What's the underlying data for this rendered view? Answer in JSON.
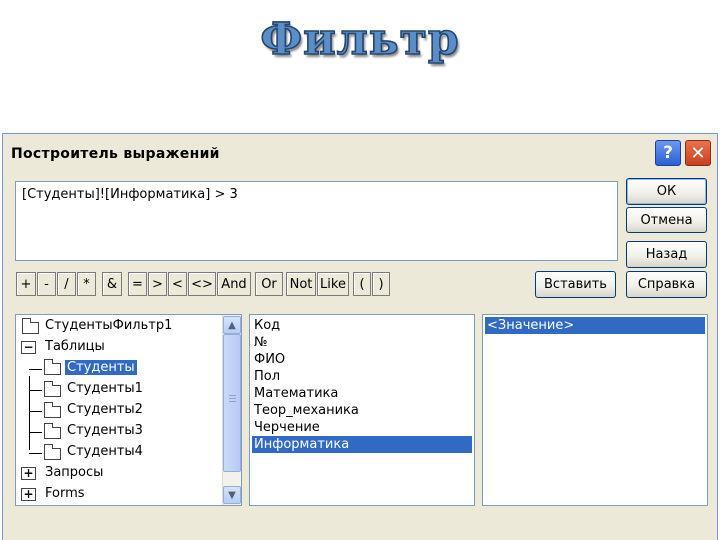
{
  "slide": {
    "title": "Фильтр"
  },
  "dialog": {
    "title": "Построитель выражений",
    "help_label": "?",
    "close_label": "✕",
    "expression": "[Студенты]![Информатика] > 3",
    "buttons": {
      "ok": "ОК",
      "cancel": "Отмена",
      "back": "Назад",
      "insert": "Вставить",
      "help": "Справка"
    },
    "operators": [
      "+",
      "-",
      "/",
      "*",
      "&",
      "=",
      ">",
      "<",
      "<>",
      "And",
      "Or",
      "Not",
      "Like",
      "(",
      ")"
    ],
    "tree": {
      "items": [
        {
          "label": "СтудентыФильтр1"
        },
        {
          "label": "Таблицы",
          "expander": "−"
        },
        {
          "label": "Студенты"
        },
        {
          "label": "Студенты1"
        },
        {
          "label": "Студенты2"
        },
        {
          "label": "Студенты3"
        },
        {
          "label": "Студенты4"
        },
        {
          "label": "Запросы",
          "expander": "+"
        },
        {
          "label": "Forms",
          "expander": "+"
        }
      ]
    },
    "fields": [
      "Код",
      "№",
      "ФИО",
      "Пол",
      "Математика",
      "Теор_механика",
      "Черчение",
      "Информатика"
    ],
    "values": [
      "<Значение>"
    ]
  }
}
